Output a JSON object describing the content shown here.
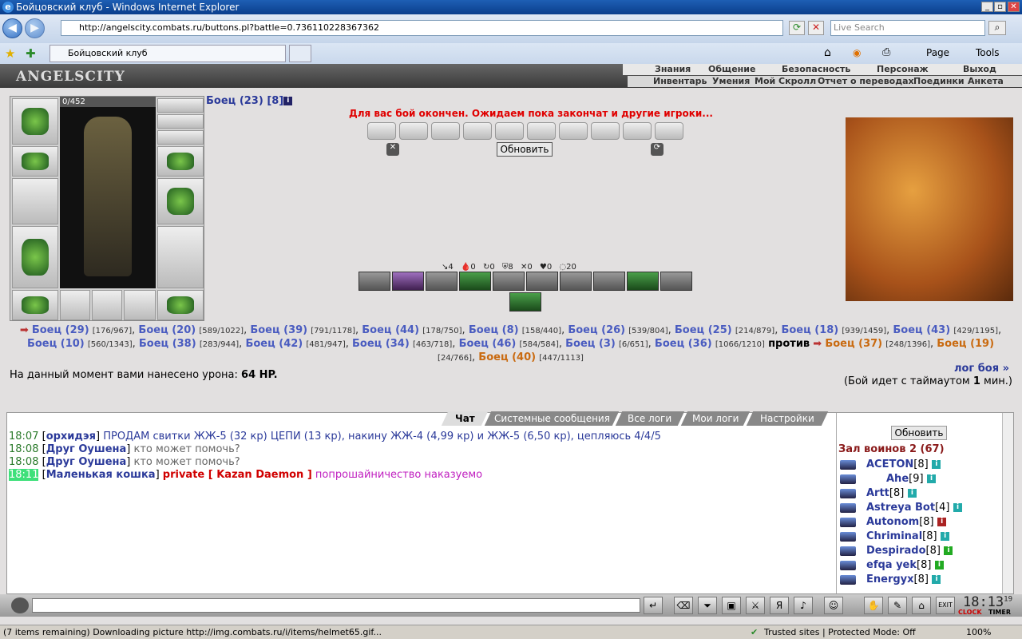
{
  "window": {
    "title": "Бойцовский клуб - Windows Internet Explorer"
  },
  "address": {
    "url": "http://angelscity.combats.ru/buttons.pl?battle=0.736110228367362",
    "search_placeholder": "Live Search"
  },
  "tab": {
    "label": "Бойцовский клуб"
  },
  "ie_tools": {
    "page": "Page",
    "tools": "Tools"
  },
  "site": {
    "logo": "ANGELSCITY"
  },
  "menu1": [
    "Знания",
    "Общение",
    "Безопасность",
    "Персонаж",
    "Выход"
  ],
  "menu2": [
    "Инвентарь",
    "Умения",
    "Мой Скролл",
    "Отчет о переводах",
    "Поединки",
    "Анкета"
  ],
  "player": {
    "name": "Боец (23) [8]",
    "hp": "0/452"
  },
  "battle": {
    "ended_message": "Для вас бой окончен. Ожидаем пока закончат и другие игроки...",
    "refresh": "Обновить"
  },
  "stats": [
    "↘4",
    "🩸0",
    "↻0",
    "⛨8",
    "✕0",
    "♥0",
    "◌20"
  ],
  "team1": [
    {
      "name": "Боец (29)",
      "hp": "[176/967]"
    },
    {
      "name": "Боец (20)",
      "hp": "[589/1022]"
    },
    {
      "name": "Боец (39)",
      "hp": "[791/1178]"
    },
    {
      "name": "Боец (44)",
      "hp": "[178/750]"
    },
    {
      "name": "Боец (8)",
      "hp": "[158/440]"
    },
    {
      "name": "Боец (26)",
      "hp": "[539/804]"
    },
    {
      "name": "Боец (25)",
      "hp": "[214/879]"
    },
    {
      "name": "Боец (18)",
      "hp": "[939/1459]"
    },
    {
      "name": "Боец (43)",
      "hp": "[429/1195]"
    },
    {
      "name": "Боец (10)",
      "hp": "[560/1343]"
    },
    {
      "name": "Боец (38)",
      "hp": "[283/944]"
    },
    {
      "name": "Боец (42)",
      "hp": "[481/947]"
    },
    {
      "name": "Боец (34)",
      "hp": "[463/718]"
    },
    {
      "name": "Боец (46)",
      "hp": "[584/584]"
    },
    {
      "name": "Боец (3)",
      "hp": "[6/651]"
    },
    {
      "name": "Боец (36)",
      "hp": "[1066/1210]"
    }
  ],
  "vs": "против",
  "team2": [
    {
      "name": "Боец (37)",
      "hp": "[248/1396]"
    },
    {
      "name": "Боец (19)",
      "hp": "[24/766]"
    },
    {
      "name": "Боец (40)",
      "hp": "[447/1113]"
    }
  ],
  "damage": {
    "prefix": "На данный момент вами нанесено урона: ",
    "value": "64 HP."
  },
  "battle_log": {
    "link": "лог боя »",
    "timeout_prefix": "(Бой идет с таймаутом ",
    "timeout_value": "1",
    "timeout_suffix": " мин.)"
  },
  "chat_tabs": [
    "Чат",
    "Системные сообщения",
    "Все логи",
    "Мои логи",
    "Настройки"
  ],
  "chat": [
    {
      "time": "18:07",
      "nick": "орхидэя",
      "text": "ПРОДАМ свитки ЖЖ-5 (32 кр) ЦЕПИ (13 кр), накину ЖЖ-4 (4,99 кр) и ЖЖ-5 (6,50 кр), цепляюсь 4/4/5"
    },
    {
      "time": "18:08",
      "nick": "Друг Оушена",
      "text": "кто может помочь?"
    },
    {
      "time": "18:08",
      "nick": "Друг Оушена",
      "text": "кто может помочь?"
    },
    {
      "time": "18:11",
      "nick": "Маленькая кошка",
      "private": "private [ Kazan Daemon ]",
      "text": "попрошайничество наказуемо"
    }
  ],
  "sidebar": {
    "refresh": "Обновить",
    "hall": "Зал воинов 2 (67)",
    "players": [
      {
        "name": "ACETON",
        "level": "[8]"
      },
      {
        "name": "Ahe",
        "level": "[9]"
      },
      {
        "name": "Artt",
        "level": "[8]"
      },
      {
        "name": "Astreya Bot",
        "level": "[4]"
      },
      {
        "name": "Autonom",
        "level": "[8]"
      },
      {
        "name": "Chriminal",
        "level": "[8]"
      },
      {
        "name": "Despirado",
        "level": "[8]"
      },
      {
        "name": "efqa yek",
        "level": "[8]"
      },
      {
        "name": "Energyx",
        "level": "[8]"
      }
    ]
  },
  "clock": {
    "time": "18:13",
    "sec": "19",
    "label1": "CLOCK",
    "label2": "TIMER"
  },
  "status": {
    "text": "(7 items remaining) Downloading picture http://img.combats.ru/i/items/helmet65.gif...",
    "zone": "Trusted sites | Protected Mode: Off",
    "zoom": "100%"
  }
}
